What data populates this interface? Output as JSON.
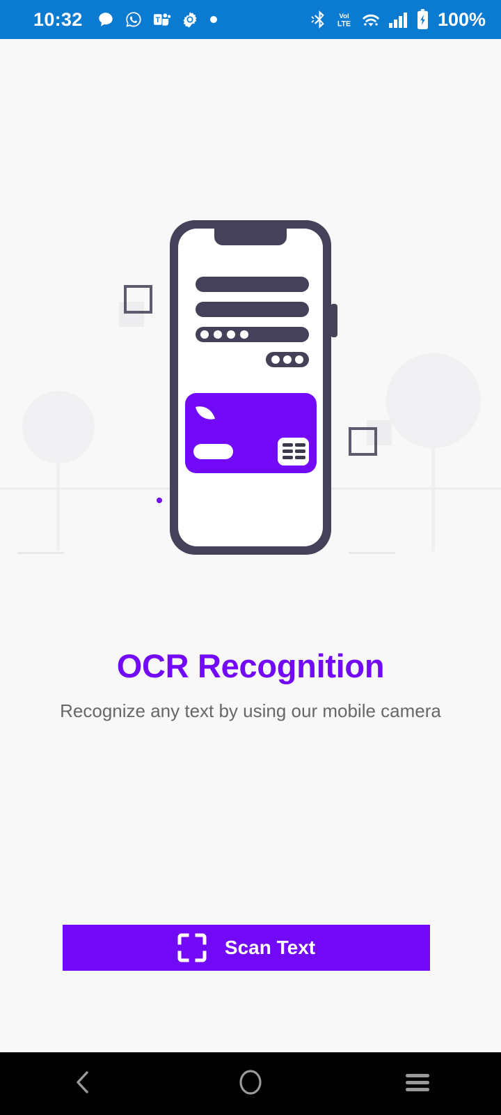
{
  "status_bar": {
    "time": "10:32",
    "battery_percent": "100%",
    "background_color": "#0b7ad1",
    "left_icons": [
      {
        "name": "chat-bubble-icon",
        "label": "Messages"
      },
      {
        "name": "whatsapp-icon",
        "label": "WhatsApp"
      },
      {
        "name": "microsoft-teams-icon",
        "label": "Teams"
      },
      {
        "name": "gear-icon",
        "label": "Settings"
      },
      {
        "name": "dot-icon",
        "label": "More notifications"
      }
    ],
    "right_icons": [
      {
        "name": "bluetooth-icon",
        "label": "Bluetooth"
      },
      {
        "name": "volte-icon",
        "label": "VoLTE"
      },
      {
        "name": "wifi-icon",
        "label": "Wi-Fi"
      },
      {
        "name": "signal-bars-icon",
        "label": "Cellular signal"
      },
      {
        "name": "battery-charging-icon",
        "label": "Battery charging"
      }
    ]
  },
  "illustration": {
    "name": "ocr-phone-illustration",
    "phone_frame_color": "#454159",
    "screen_color": "#ffffff",
    "card_color": "#7209f7",
    "scenery_color": "#f0f0f2",
    "accent_dot_color": "#7209f7"
  },
  "content": {
    "title": "OCR Recognition",
    "subtitle": "Recognize any text by using our mobile camera",
    "title_color": "#7209f7",
    "subtitle_color": "#676767"
  },
  "scan_button": {
    "label": "Scan Text",
    "icon": "scan-frame-icon",
    "background_color": "#7209f7",
    "text_color": "#ffffff"
  },
  "nav_bar": {
    "background_color": "#000000",
    "icon_color": "#9a9a9a",
    "buttons": [
      {
        "name": "nav-back-button",
        "icon": "chevron-left-icon",
        "label": "Back"
      },
      {
        "name": "nav-home-button",
        "icon": "circle-icon",
        "label": "Home"
      },
      {
        "name": "nav-recents-button",
        "icon": "hamburger-icon",
        "label": "Recents"
      }
    ]
  }
}
